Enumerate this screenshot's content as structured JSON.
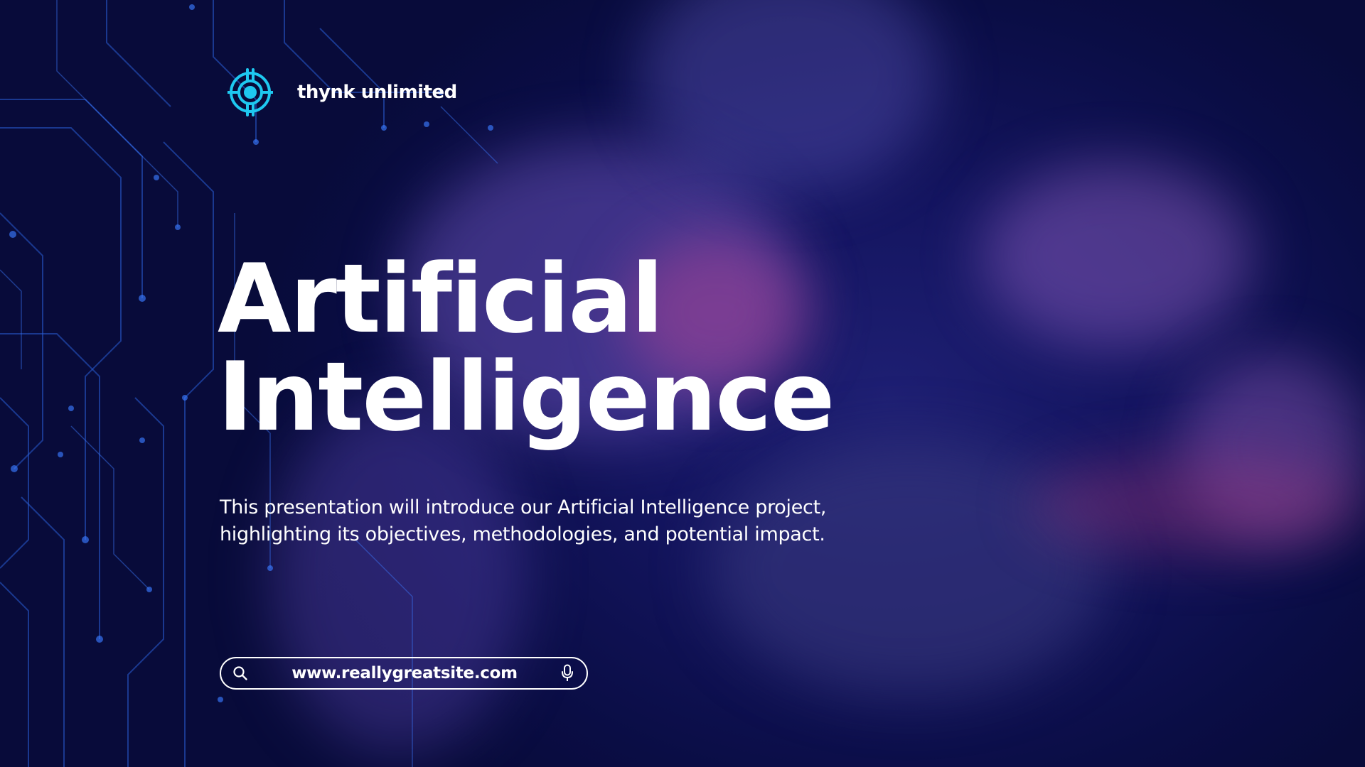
{
  "colors": {
    "background": "#0b0f4a",
    "accent": "#1ec8f0",
    "text": "#ffffff",
    "circuit": "#2a5fd6",
    "glow_pink": "#b24a9a"
  },
  "brand": {
    "name": "thynk unlimited",
    "logo_icon": "crosshair-target-icon"
  },
  "hero": {
    "title_line1": "Artificial",
    "title_line2": "Intelligence",
    "subtitle_line1": "This presentation will introduce our Artificial Intelligence project,",
    "subtitle_line2": "highlighting its objectives, methodologies, and potential impact."
  },
  "search_bar": {
    "url": "www.reallygreatsite.com",
    "left_icon": "search-icon",
    "right_icon": "microphone-icon"
  }
}
